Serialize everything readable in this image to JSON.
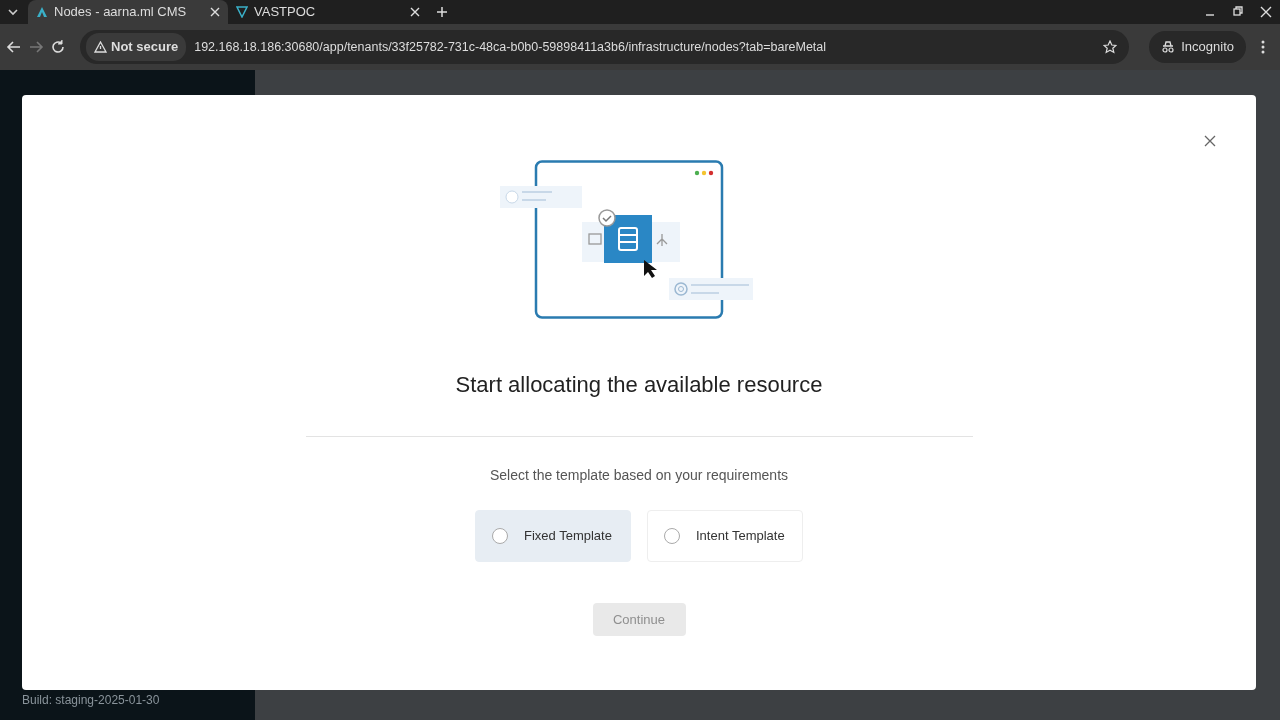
{
  "browser": {
    "tabs": [
      {
        "title": "Nodes - aarna.ml CMS",
        "selected": true
      },
      {
        "title": "VASTPOC",
        "selected": false
      }
    ],
    "security": "Not secure",
    "url": "192.168.18.186:30680/app/tenants/33f25782-731c-48ca-b0b0-59898411a3b6/infrastructure/nodes?tab=bareMetal",
    "profile": "Incognito"
  },
  "sidebar": {
    "build": "Build: staging-2025-01-30"
  },
  "modal": {
    "title": "Start allocating the available resource",
    "prompt": "Select the template based on your requirements",
    "options": [
      {
        "label": "Fixed Template",
        "selected": false,
        "hovered": true
      },
      {
        "label": "Intent Template",
        "selected": false,
        "hovered": false
      }
    ],
    "continue": {
      "label": "Continue",
      "disabled": true
    }
  }
}
